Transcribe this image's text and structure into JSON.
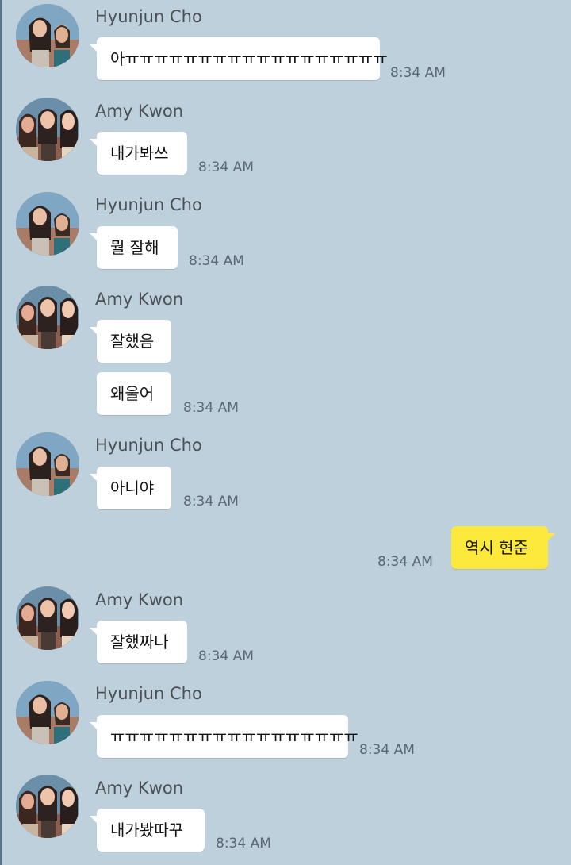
{
  "messages": [
    {
      "sender": "Hyunjun Cho",
      "text": "아ㅠㅠㅠㅠㅠㅠㅠㅠㅠㅠㅠㅠㅠㅠㅠㅠㅠㅠ",
      "time": "8:34 AM"
    },
    {
      "sender": "Amy Kwon",
      "text": "내가봐쓰",
      "time": "8:34 AM"
    },
    {
      "sender": "Hyunjun Cho",
      "text": "뭘 잘해",
      "time": "8:34 AM"
    },
    {
      "sender": "Amy Kwon",
      "text": "잘했음"
    },
    {
      "text": "왜울어",
      "time": "8:34 AM"
    },
    {
      "sender": "Hyunjun Cho",
      "text": "아니야",
      "time": "8:34 AM"
    },
    {
      "text": "역시 현준",
      "time": "8:34 AM"
    },
    {
      "sender": "Amy Kwon",
      "text": "잘했짜나",
      "time": "8:34 AM"
    },
    {
      "sender": "Hyunjun Cho",
      "text": "ㅠㅠㅠㅠㅠㅠㅠㅠㅠㅠㅠㅠㅠㅠㅠㅠㅠ",
      "time": "8:34 AM"
    },
    {
      "sender": "Amy Kwon",
      "text": "내가봤따꾸",
      "time": "8:34 AM"
    }
  ],
  "colors": {
    "background": "#bdd0dc",
    "incoming_bubble": "#ffffff",
    "outgoing_bubble": "#fde93c",
    "sender_text": "#4b4f54",
    "time_text": "#5a6670"
  }
}
